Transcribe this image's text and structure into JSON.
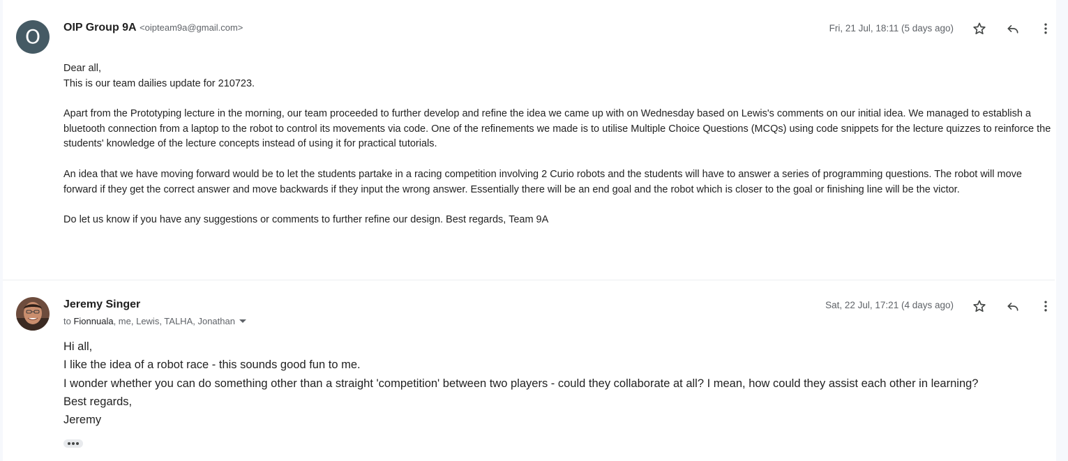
{
  "messages": [
    {
      "avatar_letter": "O",
      "sender_name": "OIP Group 9A",
      "sender_email": "<oipteam9a@gmail.com>",
      "date": "Fri, 21 Jul, 18:11 (5 days ago)",
      "actions": {
        "star": "star-icon",
        "reply": "reply-icon",
        "more": "more-vert-icon"
      },
      "body": [
        "Dear all,",
        "This is our team dailies update for 210723.",
        "Apart from the Prototyping lecture in the morning, our team proceeded to further develop and refine the idea we came up with on Wednesday based on Lewis's comments on our initial idea. We managed to establish a bluetooth connection from a laptop to the robot to control its movements via code. One of the refinements we made is to utilise Multiple Choice Questions (MCQs) using code snippets for the lecture quizzes to reinforce the students' knowledge of the lecture concepts instead of using it for practical tutorials.",
        "An idea that we have moving forward would be to let the students partake in a racing competition involving 2 Curio robots and the students will have to answer a series of programming questions. The robot will move forward if they get the correct answer and move backwards if they input the wrong answer. Essentially there will be an end goal and the robot which is closer to the goal or finishing line will be the victor.",
        "Do let us know if you have any suggestions or comments to further refine our design. Best regards, Team 9A"
      ]
    },
    {
      "sender_name": "Jeremy Singer",
      "recipients_prefix": "to",
      "recipients_first": "Fionnuala",
      "recipients_rest": ", me, Lewis, TALHA, Jonathan",
      "date": "Sat, 22 Jul, 17:21 (4 days ago)",
      "actions": {
        "star": "star-icon",
        "reply": "reply-icon",
        "more": "more-vert-icon",
        "details": "chevron-down-icon",
        "trimmed": "more-horiz-icon"
      },
      "body": [
        "Hi all,",
        "I like the idea of a robot race - this sounds good fun to me.",
        "I wonder whether you can do something other than a straight 'competition' between two players - could they collaborate at all? I mean, how could they assist each other in learning?",
        "Best regards,",
        "Jeremy"
      ]
    }
  ],
  "colors": {
    "avatar_bg": "#455a64",
    "muted_text": "#5f6368",
    "body_text": "#222222",
    "icon": "#444746"
  }
}
